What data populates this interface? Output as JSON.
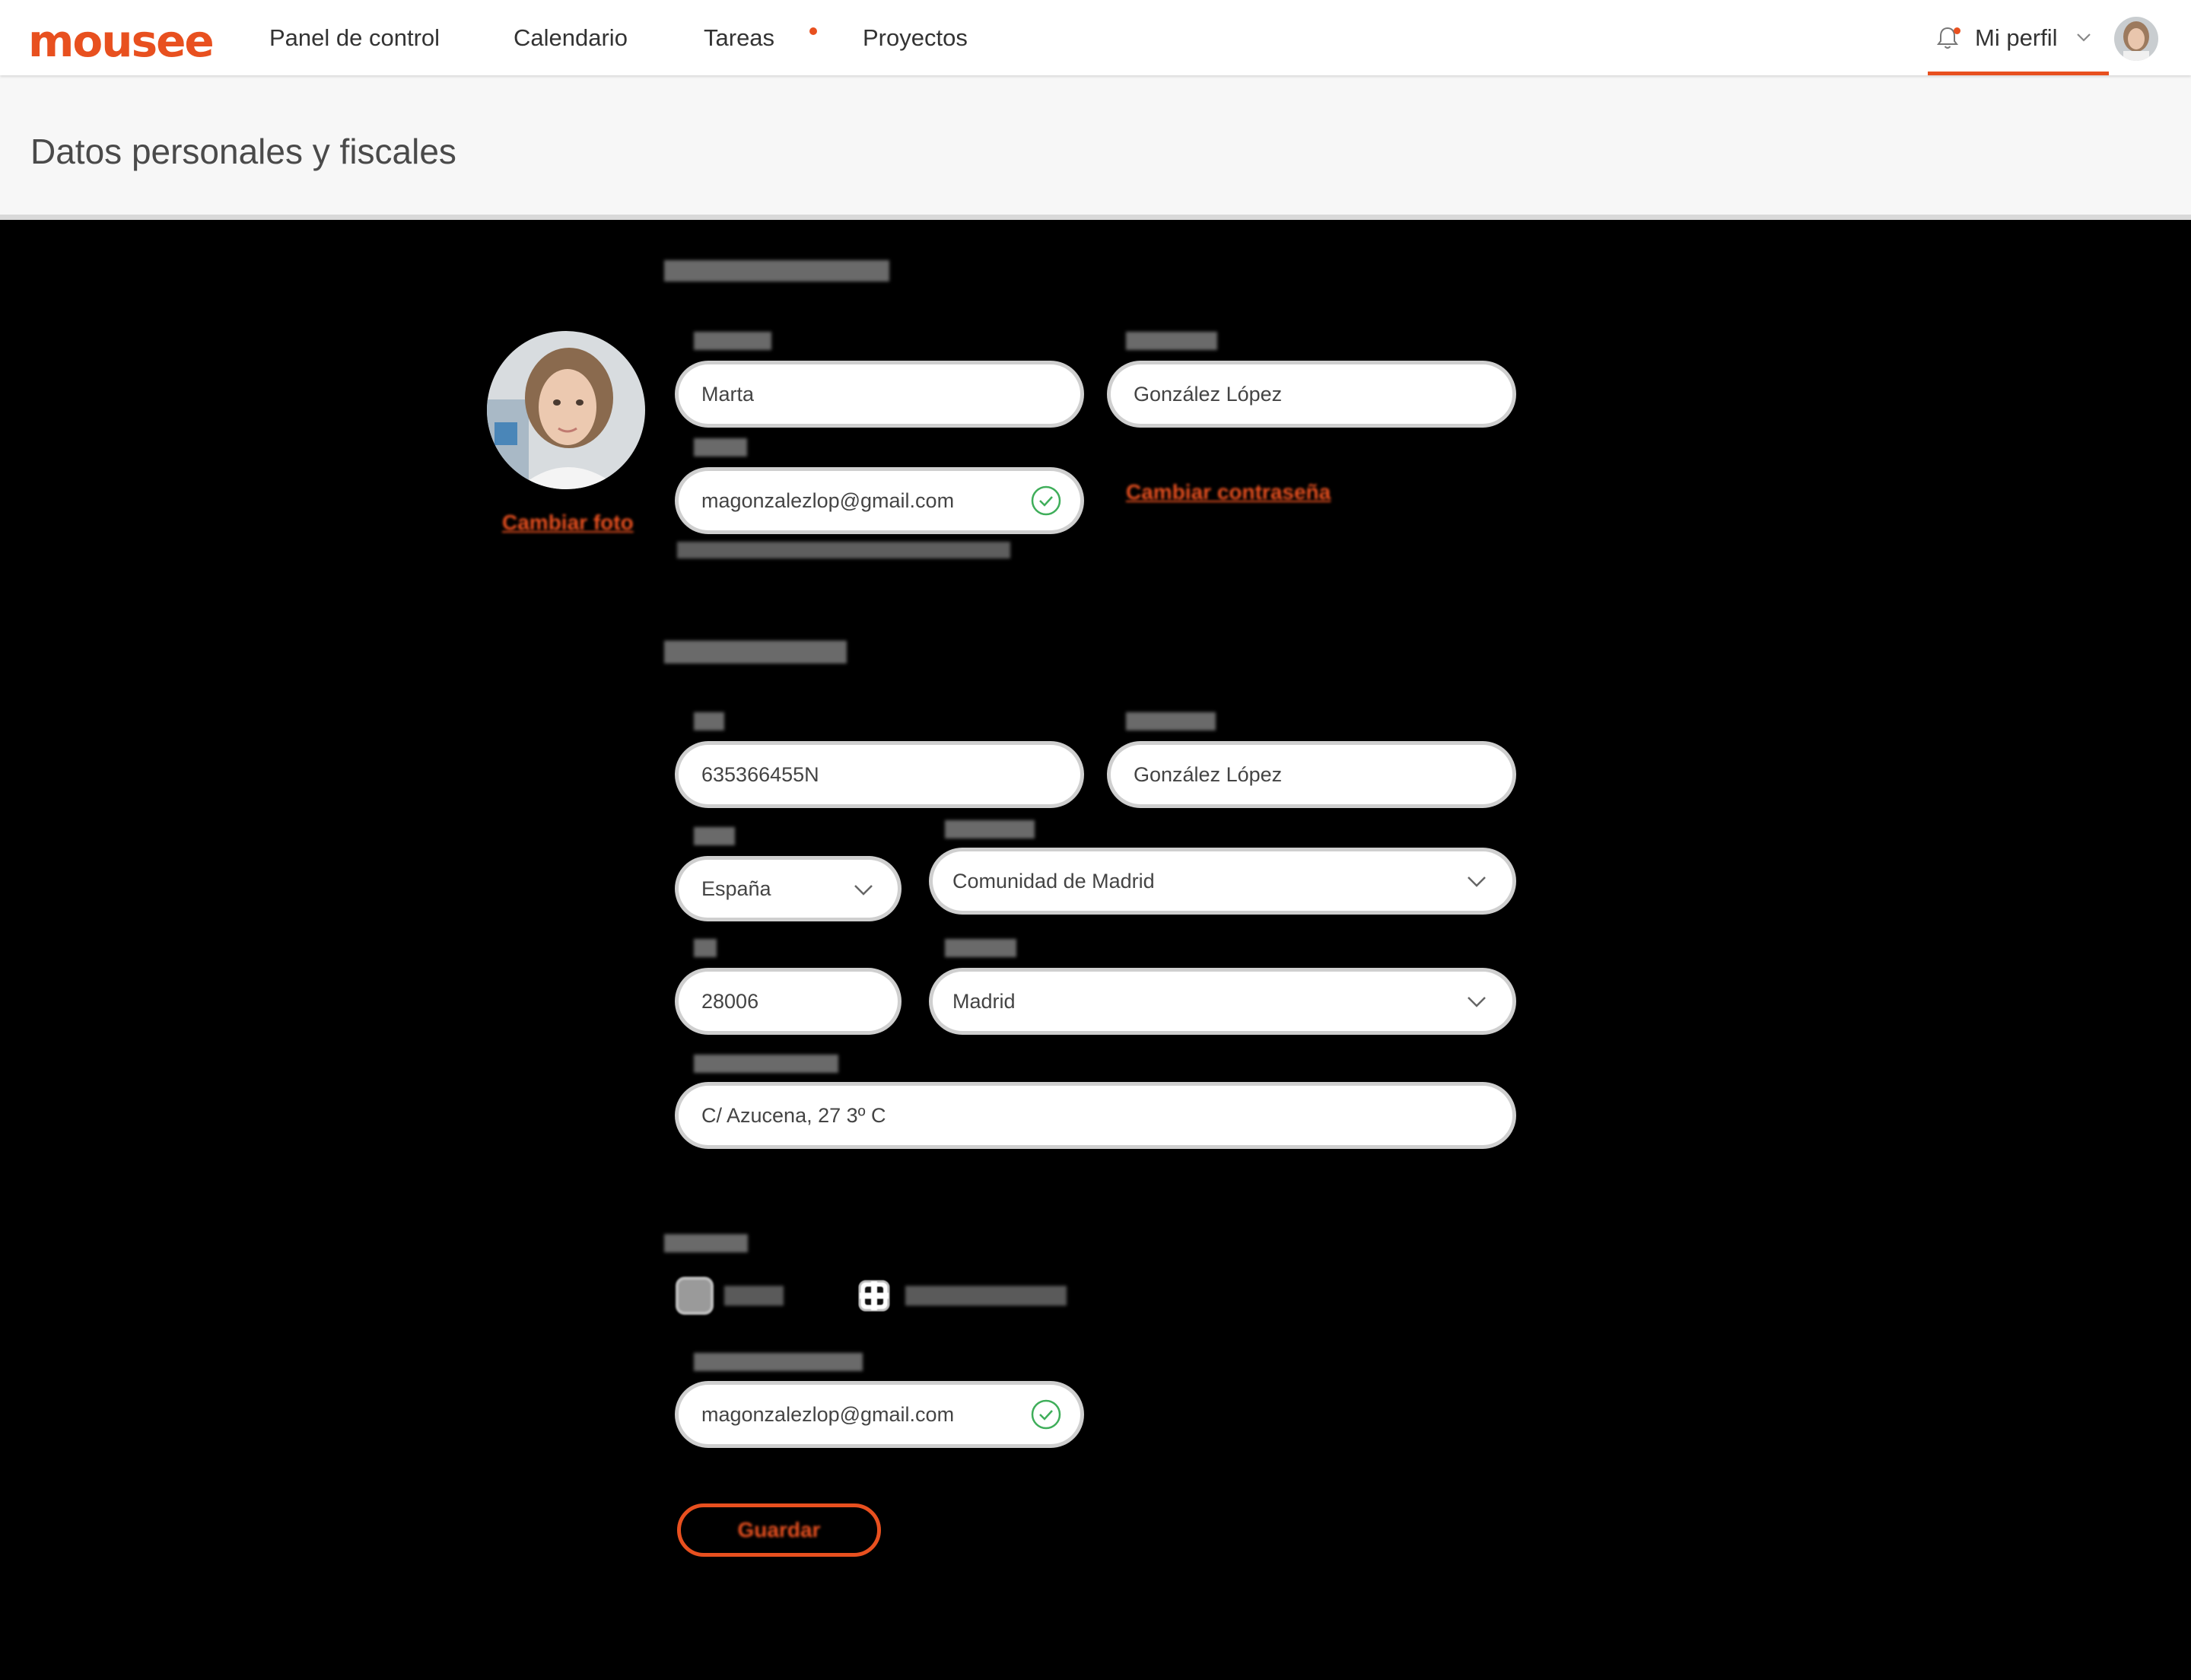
{
  "app": {
    "logo_text": "mousee",
    "accent_color": "#e8501f"
  },
  "nav": {
    "items": [
      {
        "label": "Panel de control"
      },
      {
        "label": "Calendario"
      },
      {
        "label": "Tareas"
      },
      {
        "label": "Proyectos"
      }
    ],
    "profile_label": "Mi perfil",
    "icons": [
      "bell-icon",
      "chevron-down-icon",
      "avatar"
    ]
  },
  "header": {
    "title": "Datos personales y fiscales"
  },
  "personal": {
    "name_value": "Marta",
    "surname_value": "González López",
    "email_value": "magonzalezlop@gmail.com"
  },
  "fiscal": {
    "nif_value": "635366455N",
    "apellidos_value": "González López",
    "country_value": "España",
    "region_value": "Comunidad de Madrid",
    "postal_value": "28006",
    "city_value": "Madrid",
    "address_value": "C/ Azucena, 27 3º C"
  },
  "notifications": {
    "email_value": "magonzalezlop@gmail.com"
  }
}
